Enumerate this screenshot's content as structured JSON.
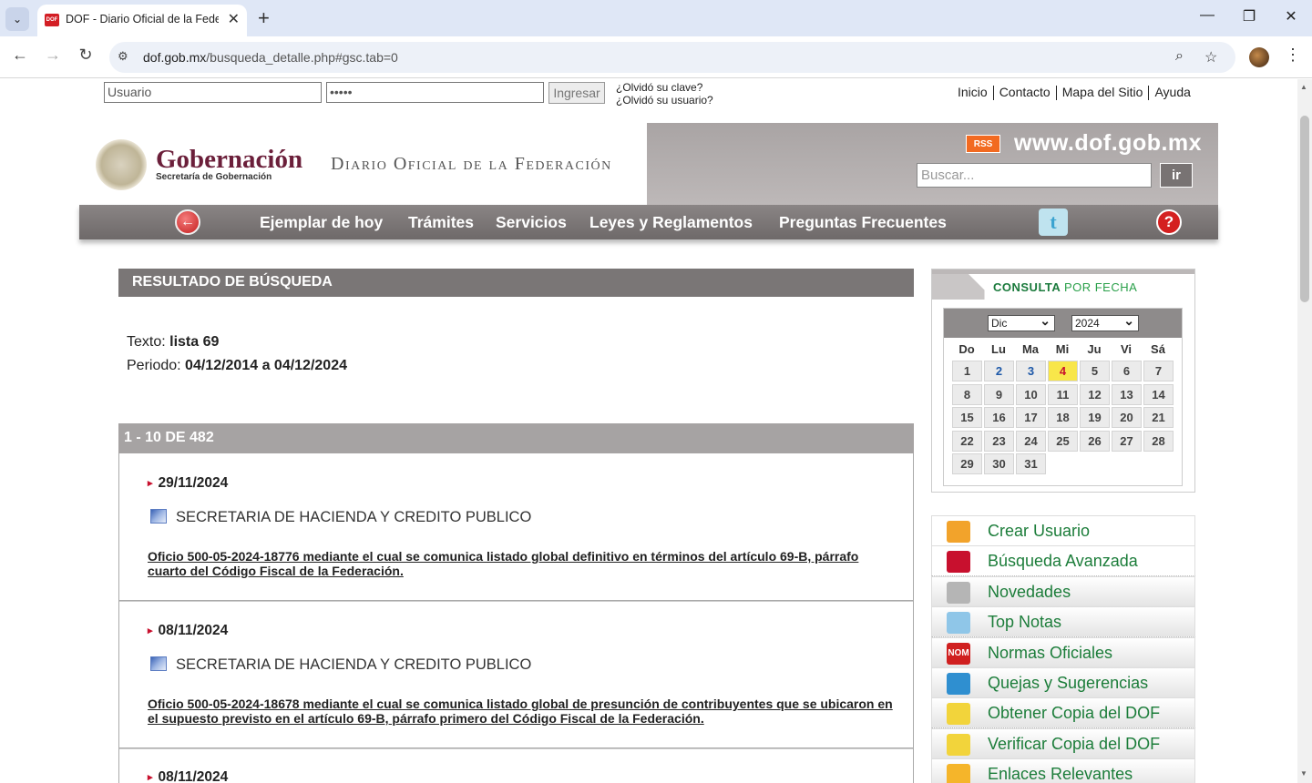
{
  "browser": {
    "tab_title": "DOF - Diario Oficial de la Federación",
    "tab_favicon_text": "DOF",
    "url_host": "dof.gob.mx",
    "url_path": "/busqueda_detalle.php#gsc.tab=0"
  },
  "login": {
    "user_value": "Usuario",
    "password_value": "•••••",
    "submit_label": "Ingresar",
    "forgot_password": "¿Olvidó su clave?",
    "forgot_user": "¿Olvidó su usuario?"
  },
  "top_links": [
    "Inicio",
    "Contacto",
    "Mapa del Sitio",
    "Ayuda"
  ],
  "header": {
    "brand_title": "Gobernación",
    "brand_subtitle": "Secretaría de Gobernación",
    "dof_title": "Diario Oficial de la Federación",
    "rss_label": "RSS",
    "site_url": "www.dof.gob.mx",
    "search_placeholder": "Buscar...",
    "search_button": "ir"
  },
  "nav": {
    "items": [
      "Ejemplar de hoy",
      "Trámites",
      "Servicios",
      "Leyes y Reglamentos",
      "Preguntas Frecuentes"
    ],
    "twitter_glyph": "t",
    "help_glyph": "?"
  },
  "results_header": "RESULTADO DE BÚSQUEDA",
  "query": {
    "text_label": "Texto:",
    "text_value": "lista 69",
    "period_label": "Periodo:",
    "period_value": "04/12/2014 a 04/12/2024"
  },
  "count_label": "1 - 10 DE 482",
  "results": [
    {
      "date": "29/11/2024",
      "secretaria": "SECRETARIA DE HACIENDA Y CREDITO PUBLICO",
      "title": "Oficio 500-05-2024-18776 mediante el cual se comunica listado global definitivo en términos del artículo 69-B, párrafo cuarto del Código Fiscal de la Federación."
    },
    {
      "date": "08/11/2024",
      "secretaria": "SECRETARIA DE HACIENDA Y CREDITO PUBLICO",
      "title": "Oficio 500-05-2024-18678 mediante el cual se comunica listado global de presunción de contribuyentes que se ubicaron en el supuesto previsto en el artículo 69-B, párrafo primero del Código Fiscal de la Federación."
    },
    {
      "date": "08/11/2024"
    }
  ],
  "calendar": {
    "label_main": "CONSULTA",
    "label_sub": "POR FECHA",
    "month": "Dic",
    "year": "2024",
    "weekdays": [
      "Do",
      "Lu",
      "Ma",
      "Mi",
      "Ju",
      "Vi",
      "Sá"
    ],
    "first_weekday_index": 0,
    "days": [
      "1",
      "2",
      "3",
      "4",
      "5",
      "6",
      "7",
      "8",
      "9",
      "10",
      "11",
      "12",
      "13",
      "14",
      "15",
      "16",
      "17",
      "18",
      "19",
      "20",
      "21",
      "22",
      "23",
      "24",
      "25",
      "26",
      "27",
      "28",
      "29",
      "30",
      "31"
    ],
    "today": "4",
    "linked_days": [
      "2",
      "3"
    ]
  },
  "side_menu": [
    {
      "label": "Crear Usuario",
      "icon": "user-add-icon",
      "color": "#f2a32b"
    },
    {
      "label": "Búsqueda Avanzada",
      "icon": "magnifier-icon",
      "color": "#c8102e"
    },
    {
      "label": "Novedades",
      "icon": "newspaper-icon",
      "color": "#b5b5b5"
    },
    {
      "label": "Top Notas",
      "icon": "star-note-icon",
      "color": "#8fc6e8"
    },
    {
      "label": "Normas Oficiales",
      "icon": "nom-icon",
      "color": "#d02020",
      "icon_text": "NOM"
    },
    {
      "label": "Quejas y Sugerencias",
      "icon": "mailbox-icon",
      "color": "#2f8fd0"
    },
    {
      "label": "Obtener Copia del DOF",
      "icon": "document-icon",
      "color": "#f2d43b"
    },
    {
      "label": "Verificar Copia del DOF",
      "icon": "document-check-icon",
      "color": "#f2d43b"
    },
    {
      "label": "Enlaces Relevantes",
      "icon": "star-icon",
      "color": "#f5b52a"
    }
  ]
}
